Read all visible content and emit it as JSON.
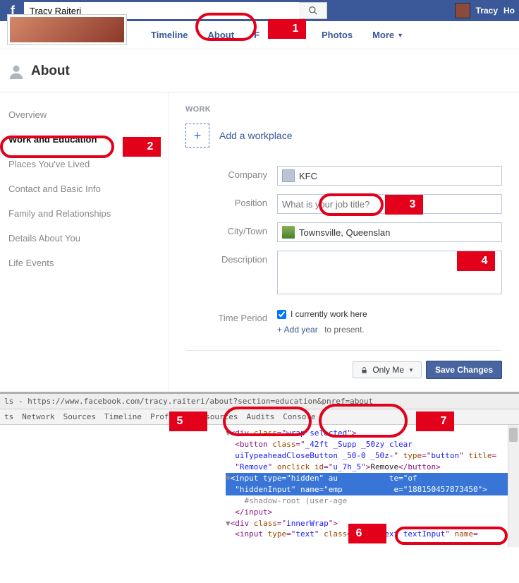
{
  "topbar": {
    "search_value": "Tracy Raiteri",
    "user_name": "Tracy",
    "nav_ho": "Ho"
  },
  "tabs": {
    "timeline": "Timeline",
    "about": "About",
    "friends_cut": "F",
    "photos": "Photos",
    "more": "More"
  },
  "about": {
    "title": "About"
  },
  "sidebar": {
    "items": [
      {
        "label": "Overview"
      },
      {
        "label": "Work and Education"
      },
      {
        "label": "Places You've Lived"
      },
      {
        "label": "Contact and Basic Info"
      },
      {
        "label": "Family and Relationships"
      },
      {
        "label": "Details About You"
      },
      {
        "label": "Life Events"
      }
    ]
  },
  "work_section": {
    "heading": "WORK",
    "add_workplace": "Add a workplace",
    "labels": {
      "company": "Company",
      "position": "Position",
      "city": "City/Town",
      "description": "Description",
      "time_period": "Time Period"
    },
    "company_value": "KFC",
    "position_placeholder": "What is your job title?",
    "city_value": "Townsville, Queenslan",
    "currently_work": "I currently work here",
    "add_year": "+ Add year",
    "to_present": "to present.",
    "privacy": "Only Me",
    "save": "Save Changes"
  },
  "devtools": {
    "url": "ls - https://www.facebook.com/tracy.raiteri/about?section=education&pnref=about",
    "tabs": [
      "ts",
      "Network",
      "Sources",
      "Timeline",
      "Profiles",
      "Resources",
      "Audits",
      "Console"
    ],
    "lines": {
      "l1_a": "▼",
      "l1_b": "<div ",
      "l1_c": "class",
      "l1_d": "=\"",
      "l1_e": "wrap selected",
      "l1_f": "\">",
      "l2_a": "  <button ",
      "l2_b": "class",
      "l2_c": "=\"",
      "l2_d": "_42ft _Supp _50zy clear",
      "l3_a": "  uiTypeaheadCloseButton _50-0 _50z-",
      "l3_b": "\" ",
      "l3_c": "type",
      "l3_d": "=\"",
      "l3_e": "button",
      "l3_f": "\" ",
      "l3_g": "title",
      "l3_h": "=",
      "l4_a": "  \"",
      "l4_b": "Remove",
      "l4_c": "\" ",
      "l4_d": "onclick id",
      "l4_e": "=\"",
      "l4_f": "u_7h_5",
      "l4_g": "\">",
      "l4_h": "Remove",
      "l4_i": "</button>",
      "l5_a": "▼",
      "l5_b": "<input ",
      "l5_c": "type",
      "l5_d": "=\"",
      "l5_e": "hidden",
      "l5_f": "\" au           te=\"of",
      "l5_g": "",
      "l6_a": "  \"",
      "l6_b": "hiddenInput",
      "l6_c": "\" ",
      "l6_d": "name",
      "l6_e": "=\"",
      "l6_f": "emp",
      "l6_g": "           e=\"",
      "l6_h": "188150457873450",
      "l6_i": "\">",
      "l7": "    #shadow-root (user-age",
      "l8": "  </input>",
      "l9_a": "▼",
      "l9_b": "<div ",
      "l9_c": "class",
      "l9_d": "=\"",
      "l9_e": "innerWrap",
      "l9_f": "\">",
      "l10_a": "  <input ",
      "l10_b": "type",
      "l10_c": "=\"",
      "l10_d": "text",
      "l10_e": "\" ",
      "l10_f": "class",
      "l10_g": "=\"",
      "l10_h": "inputtext textInput",
      "l10_i": "\" ",
      "l10_j": "name",
      "l10_k": "="
    }
  },
  "annotations": {
    "n1": "1",
    "n2": "2",
    "n3": "3",
    "n4": "4",
    "n5": "5",
    "n6": "6",
    "n7": "7"
  }
}
